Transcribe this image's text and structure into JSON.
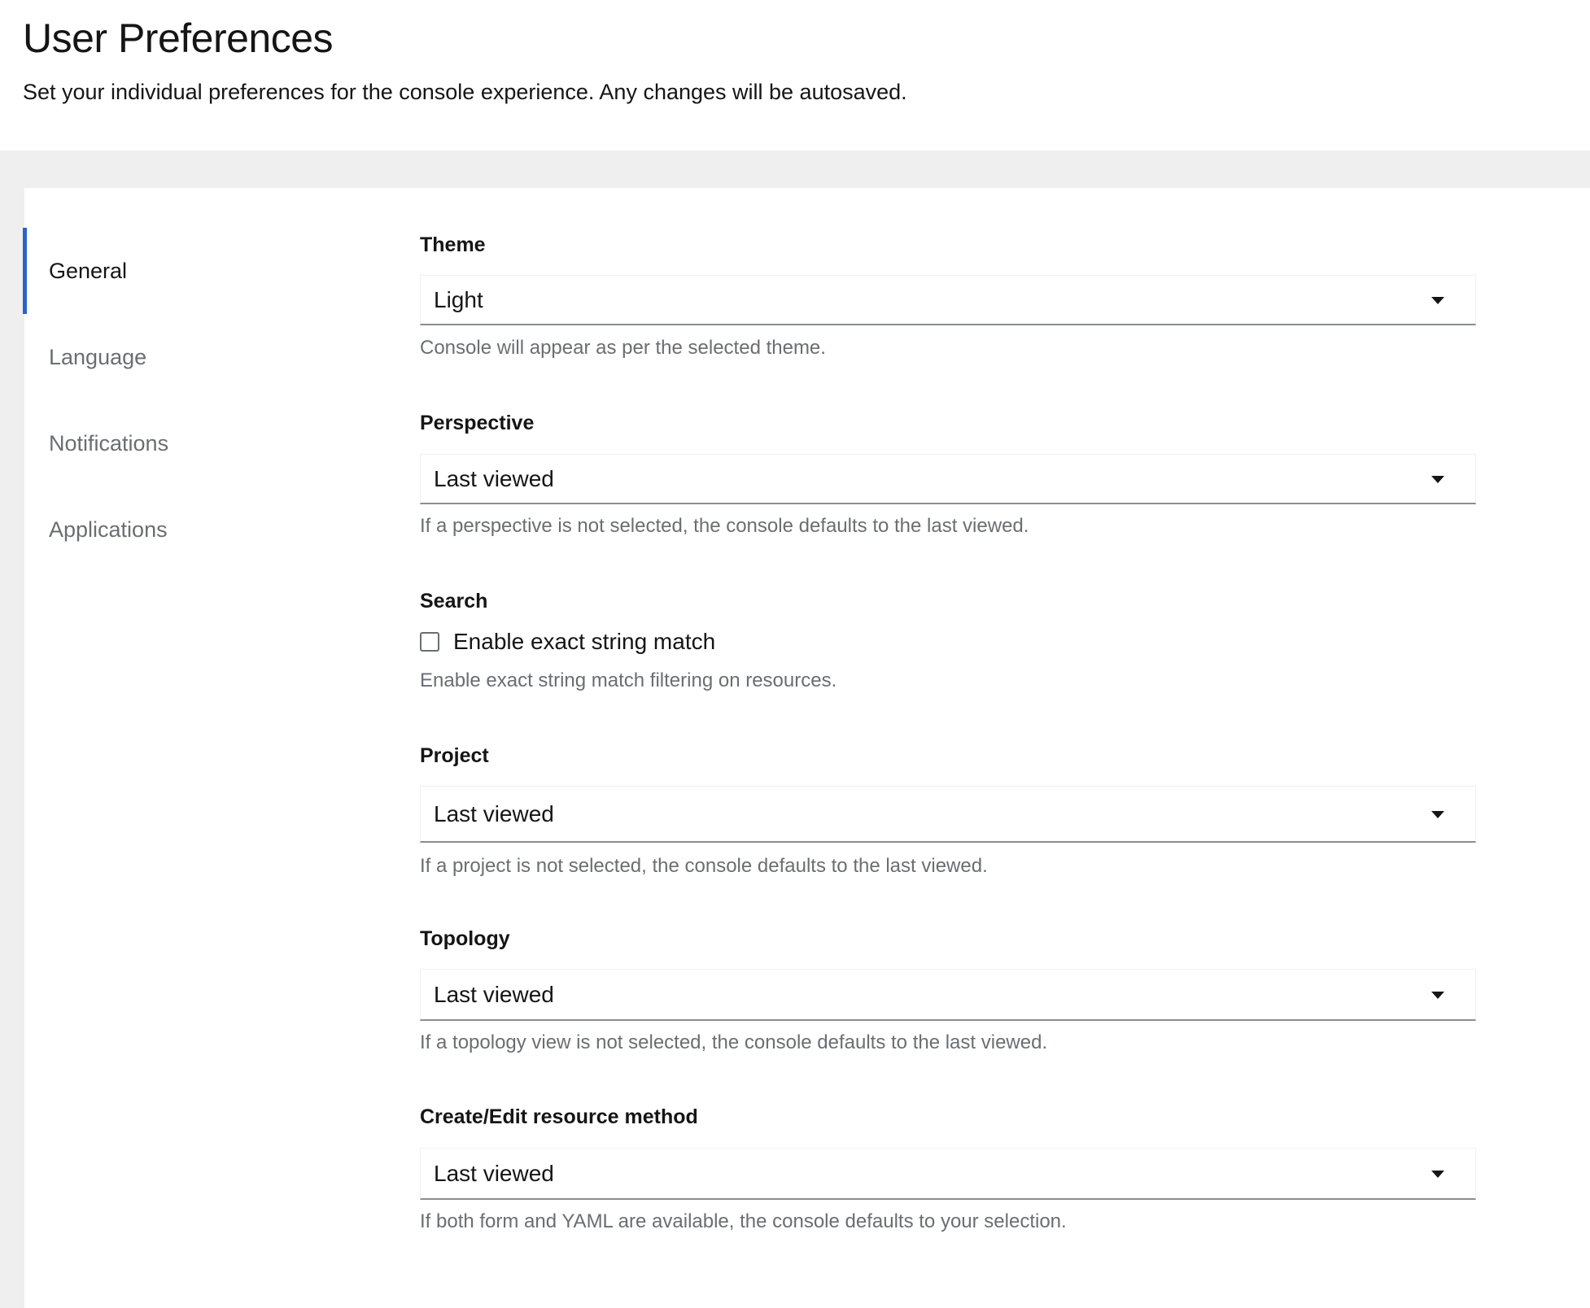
{
  "header": {
    "title": "User Preferences",
    "subtitle": "Set your individual preferences for the console experience. Any changes will be autosaved."
  },
  "nav": {
    "active": "General",
    "items": [
      {
        "label": "General"
      },
      {
        "label": "Language"
      },
      {
        "label": "Notifications"
      },
      {
        "label": "Applications"
      }
    ]
  },
  "form": {
    "theme": {
      "label": "Theme",
      "value": "Light",
      "helper": "Console will appear as per the selected theme."
    },
    "perspective": {
      "label": "Perspective",
      "value": "Last viewed",
      "helper": "If a perspective is not selected, the console defaults to the last viewed."
    },
    "search": {
      "label": "Search",
      "checkbox_label": "Enable exact string match",
      "checked": false,
      "helper": "Enable exact string match filtering on resources."
    },
    "project": {
      "label": "Project",
      "value": "Last viewed",
      "helper": "If a project is not selected, the console defaults to the last viewed."
    },
    "topology": {
      "label": "Topology",
      "value": "Last viewed",
      "helper": "If a topology view is not selected, the console defaults to the last viewed."
    },
    "create_edit": {
      "label": "Create/Edit resource method",
      "value": "Last viewed",
      "helper": "If both form and YAML are available, the console defaults to your selection."
    }
  },
  "colors": {
    "accent": "#2b64c8",
    "background_band": "#efefef",
    "helper_text": "#6a6e73"
  }
}
